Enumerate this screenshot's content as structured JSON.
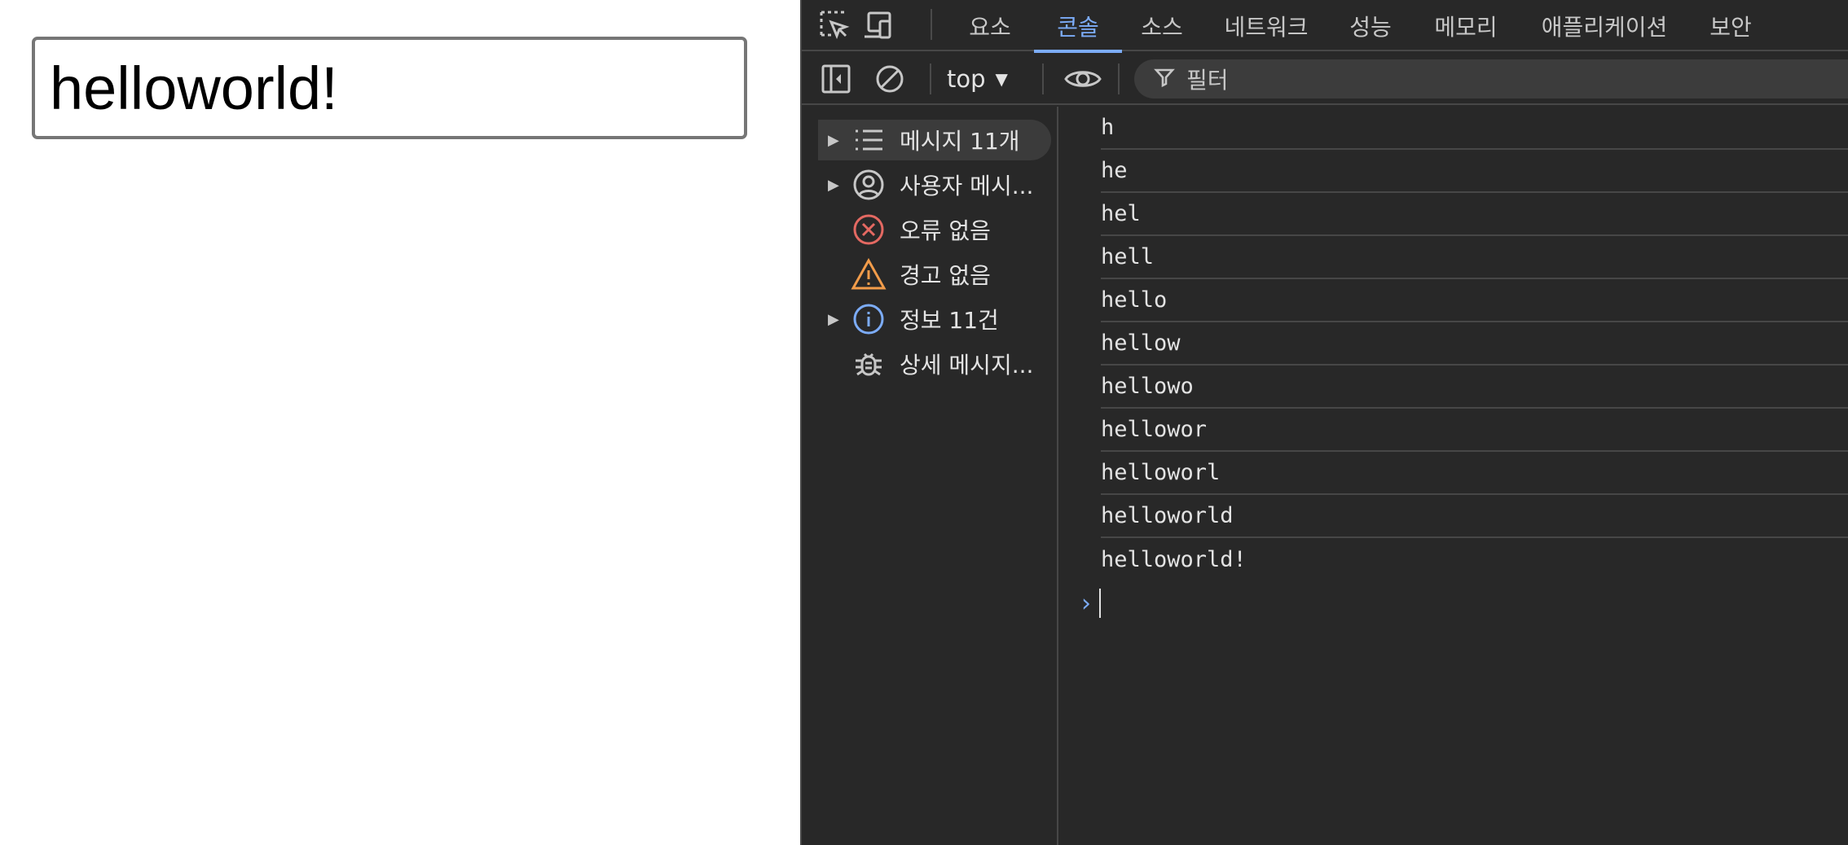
{
  "page": {
    "input_value": "helloworld!"
  },
  "devtools": {
    "tabs": [
      "요소",
      "콘솔",
      "소스",
      "네트워크",
      "성능",
      "메모리",
      "애플리케이션",
      "보안"
    ],
    "active_tab": "콘솔",
    "toolbar": {
      "context": "top",
      "filter_placeholder": "필터"
    },
    "sidebar": {
      "items": [
        {
          "label": "메시지 11개",
          "icon": "list-icon",
          "expandable": true,
          "selected": true
        },
        {
          "label": "사용자 메시...",
          "icon": "user-circle-icon",
          "expandable": true
        },
        {
          "label": "오류 없음",
          "icon": "error-icon",
          "expandable": false
        },
        {
          "label": "경고 없음",
          "icon": "warning-icon",
          "expandable": false
        },
        {
          "label": "정보 11건",
          "icon": "info-icon",
          "expandable": true
        },
        {
          "label": "상세 메시지...",
          "icon": "bug-icon",
          "expandable": false
        }
      ]
    },
    "console_logs": [
      "h",
      "he",
      "hel",
      "hell",
      "hello",
      "hellow",
      "hellowo",
      "hellowor",
      "helloworl",
      "helloworld",
      "helloworld!"
    ],
    "colors": {
      "background": "#282828",
      "accent": "#7cacf8",
      "error": "#e46962",
      "warning": "#f29c4a",
      "info": "#7cacf8"
    }
  }
}
